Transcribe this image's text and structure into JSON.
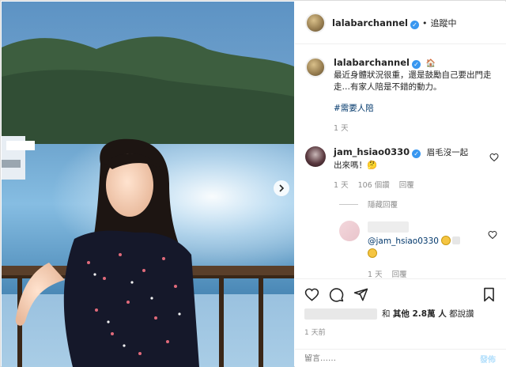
{
  "post": {
    "username": "lalabarchannel",
    "follow_label": "追蹤中",
    "caption_emoji": "🏠",
    "caption_text": "最近身體狀況很重，還是鼓勵自己要出門走走…有家人陪是不錯的動力。",
    "hashtag": "#需要人陪",
    "caption_time": "1 天"
  },
  "comments": [
    {
      "username": "jam_hsiao0330",
      "text": "眉毛沒一起出來嗎！🤔",
      "time": "1 天",
      "likes": "106 個讚",
      "reply_label": "回覆"
    }
  ],
  "hide_replies_label": "隱藏回覆",
  "reply": {
    "mention": "@jam_hsiao0330",
    "time": "1 天",
    "reply_label": "回覆"
  },
  "likes": {
    "prefix": "和",
    "others": "其他 2.8萬 人",
    "suffix": "都說讚"
  },
  "post_time": "1 天前",
  "comment_input": {
    "placeholder": "留言……",
    "post_label": "發佈"
  },
  "colors": {
    "verified": "#3897f0",
    "link": "#00376b",
    "muted": "#8e8e8e"
  }
}
